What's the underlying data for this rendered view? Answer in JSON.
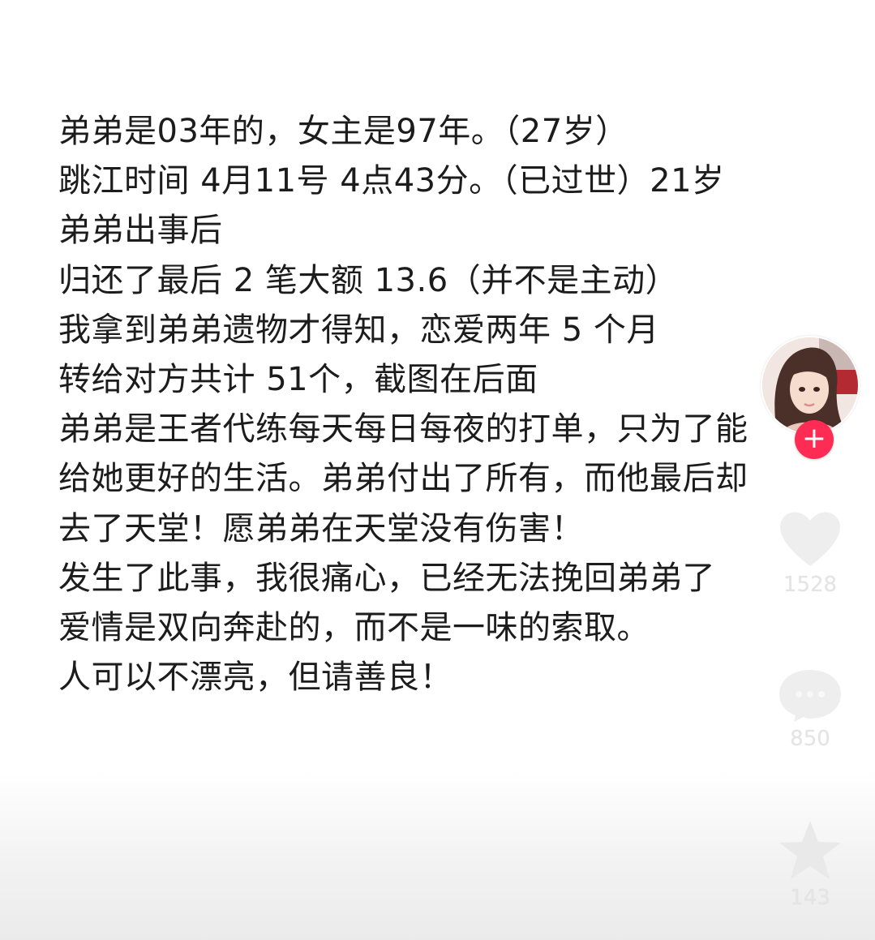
{
  "post": {
    "lines": [
      "弟弟是03年的，女主是97年。（27岁）",
      "跳江时间 4月11号 4点43分。（已过世）21岁",
      "弟弟出事后",
      "归还了最后 2 笔大额 13.6（并不是主动）",
      "我拿到弟弟遗物才得知，恋爱两年 5 个月",
      "转给对方共计 51个，截图在后面",
      "弟弟是王者代练每天每日每夜的打单，只为了能",
      "给她更好的生活。弟弟付出了所有，而他最后却",
      "去了天堂！愿弟弟在天堂没有伤害！",
      "发生了此事，我很痛心，已经无法挽回弟弟了",
      "爱情是双向奔赴的，而不是一味的索取。",
      "人可以不漂亮，但请善良！"
    ]
  },
  "rail": {
    "follow_symbol": "+",
    "like_count": "1528",
    "comment_count": "850",
    "favorite_count": "143"
  },
  "colors": {
    "follow": "#fe2c55",
    "text": "#1c1c1c",
    "faded_icon": "#eeeeee"
  }
}
